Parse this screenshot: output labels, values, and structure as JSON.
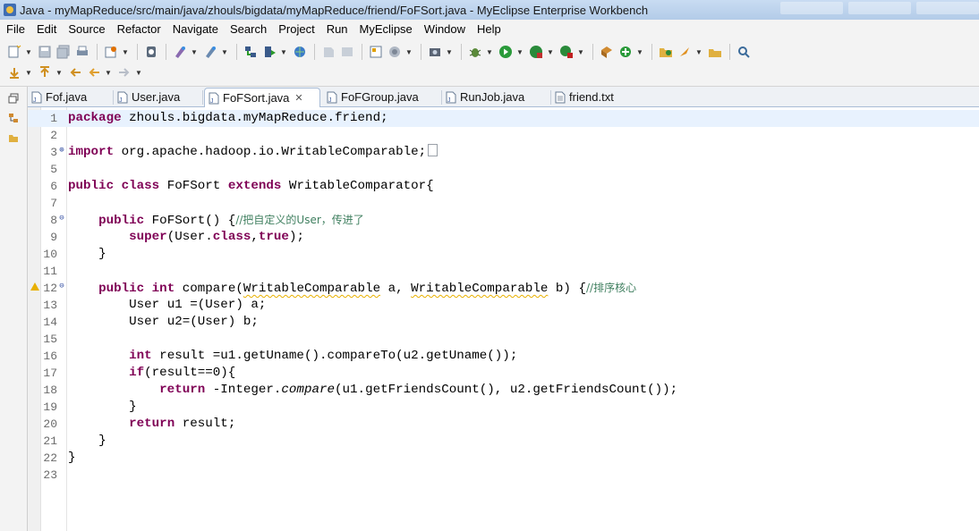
{
  "window": {
    "title": "Java - myMapReduce/src/main/java/zhouls/bigdata/myMapReduce/friend/FoFSort.java - MyEclipse Enterprise Workbench"
  },
  "menu": {
    "items": [
      "File",
      "Edit",
      "Source",
      "Refactor",
      "Navigate",
      "Search",
      "Project",
      "Run",
      "MyEclipse",
      "Window",
      "Help"
    ]
  },
  "toolbar": {
    "icons": [
      "new-icon",
      "save-icon",
      "save-all-icon",
      "print-icon",
      "new-web-project-icon",
      "server-icon",
      "new-java-icon",
      "open-type-icon",
      "deploy-icon",
      "run-server-icon",
      "browser-icon",
      "back-icon",
      "forward-icon",
      "open-perspective-icon",
      "debug-icon",
      "run-icon",
      "coverage-icon",
      "external-tools-icon",
      "new-class-icon",
      "new-package-icon",
      "open-folder-icon",
      "search-icon",
      "next-annotation-icon",
      "previous-annotation-icon",
      "last-edit-icon",
      "nav-back-icon",
      "nav-forward-icon"
    ]
  },
  "tabs": [
    {
      "label": "Fof.java",
      "active": false
    },
    {
      "label": "User.java",
      "active": false
    },
    {
      "label": "FoFSort.java",
      "active": true
    },
    {
      "label": "FoFGroup.java",
      "active": false
    },
    {
      "label": "RunJob.java",
      "active": false
    },
    {
      "label": "friend.txt",
      "active": false
    }
  ],
  "editor": {
    "line_numbers": [
      "1",
      "2",
      "3",
      "5",
      "6",
      "7",
      "8",
      "9",
      "10",
      "11",
      "12",
      "13",
      "14",
      "15",
      "16",
      "17",
      "18",
      "19",
      "20",
      "21",
      "22",
      "23"
    ],
    "lines": {
      "l1_kw": "package",
      "l1_rest": " zhouls.bigdata.myMapReduce.friend;",
      "l3_kw": "import",
      "l3_rest": " org.apache.hadoop.io.WritableComparable;",
      "l6_kw1": "public",
      "l6_kw2": "class",
      "l6_name": " FoFSort ",
      "l6_kw3": "extends",
      "l6_rest": " WritableComparator{",
      "l8_kw": "public",
      "l8_rest": " FoFSort() {",
      "l8_comment": "//把自定义的User，传进了",
      "l9_kw": "super",
      "l9_mid": "(User.",
      "l9_kw2": "class",
      "l9_sep": ",",
      "l9_kw3": "true",
      "l9_end": ");",
      "l10": "}",
      "l12_kw1": "public",
      "l12_kw2": "int",
      "l12_name": " compare(",
      "l12_type1": "WritableComparable",
      "l12_mid": " a, ",
      "l12_type2": "WritableComparable",
      "l12_end": " b) {",
      "l12_comment": "//排序核心",
      "l13": "User u1 =(User) a;",
      "l14": "User u2=(User) b;",
      "l16_kw": "int",
      "l16_rest": " result =u1.getUname().compareTo(u2.getUname());",
      "l17_kw": "if",
      "l17_rest": "(result==0){",
      "l18_kw": "return",
      "l18_pre": " -Integer.",
      "l18_it": "compare",
      "l18_rest": "(u1.getFriendsCount(), u2.getFriendsCount());",
      "l19": "}",
      "l20_kw": "return",
      "l20_rest": " result;",
      "l21": "}",
      "l22": "}"
    }
  }
}
